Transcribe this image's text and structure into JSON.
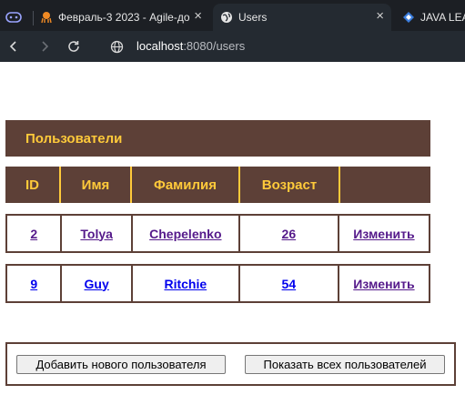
{
  "browser": {
    "tabs": [
      {
        "title": "Февраль-3 2023 - Agile-до",
        "active": false
      },
      {
        "title": "Users",
        "active": true
      },
      {
        "title": "JAVA LEAR",
        "active": false
      }
    ],
    "url_host": "localhost",
    "url_path": ":8080/users"
  },
  "page": {
    "title": "Пользователи",
    "columns": [
      "ID",
      "Имя",
      "Фамилия",
      "Возраст",
      ""
    ],
    "rows": [
      {
        "id": "2",
        "first_name": "Tolya",
        "last_name": "Chepelenko",
        "age": "26",
        "action": "Изменить"
      },
      {
        "id": "9",
        "first_name": "Guy",
        "last_name": "Ritchie",
        "age": "54",
        "action": "Изменить"
      }
    ],
    "buttons": {
      "add_user": "Добавить нового пользователя",
      "show_all": "Показать всех пользователей"
    }
  },
  "colors": {
    "header_bg": "#5d4037",
    "header_text": "#ffca3a",
    "link": "#0000ee",
    "link_visited": "#551a8b"
  }
}
